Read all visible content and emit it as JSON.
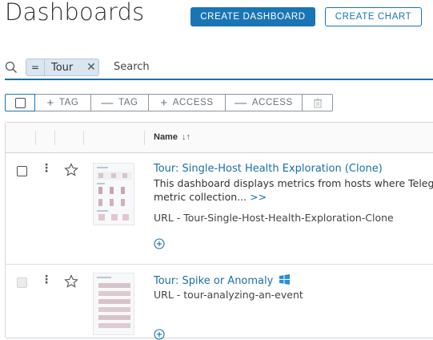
{
  "header": {
    "title": "Dashboards",
    "create_dashboard": "CREATE DASHBOARD",
    "create_chart": "CREATE CHART"
  },
  "search": {
    "filter_operator": "=",
    "filter_value": "Tour",
    "placeholder": "Search"
  },
  "toolbar": {
    "add_tag": "TAG",
    "remove_tag": "TAG",
    "add_access": "ACCESS",
    "remove_access": "ACCESS"
  },
  "table": {
    "name_header": "Name",
    "rows": [
      {
        "name": "Tour: Single-Host Health Exploration (Clone)",
        "description_line1": "This dashboard displays metrics from hosts where Teleg",
        "description_line2": "metric collection...",
        "more": ">>",
        "url": "URL - Tour-Single-Host-Health-Exploration-Clone"
      },
      {
        "name": "Tour: Spike or Anomaly",
        "url": "URL - tour-analyzing-an-event"
      }
    ]
  },
  "colors": {
    "accent": "#1a75b5",
    "link": "#1a6fa6",
    "chip_bg": "#d9e6ef"
  }
}
